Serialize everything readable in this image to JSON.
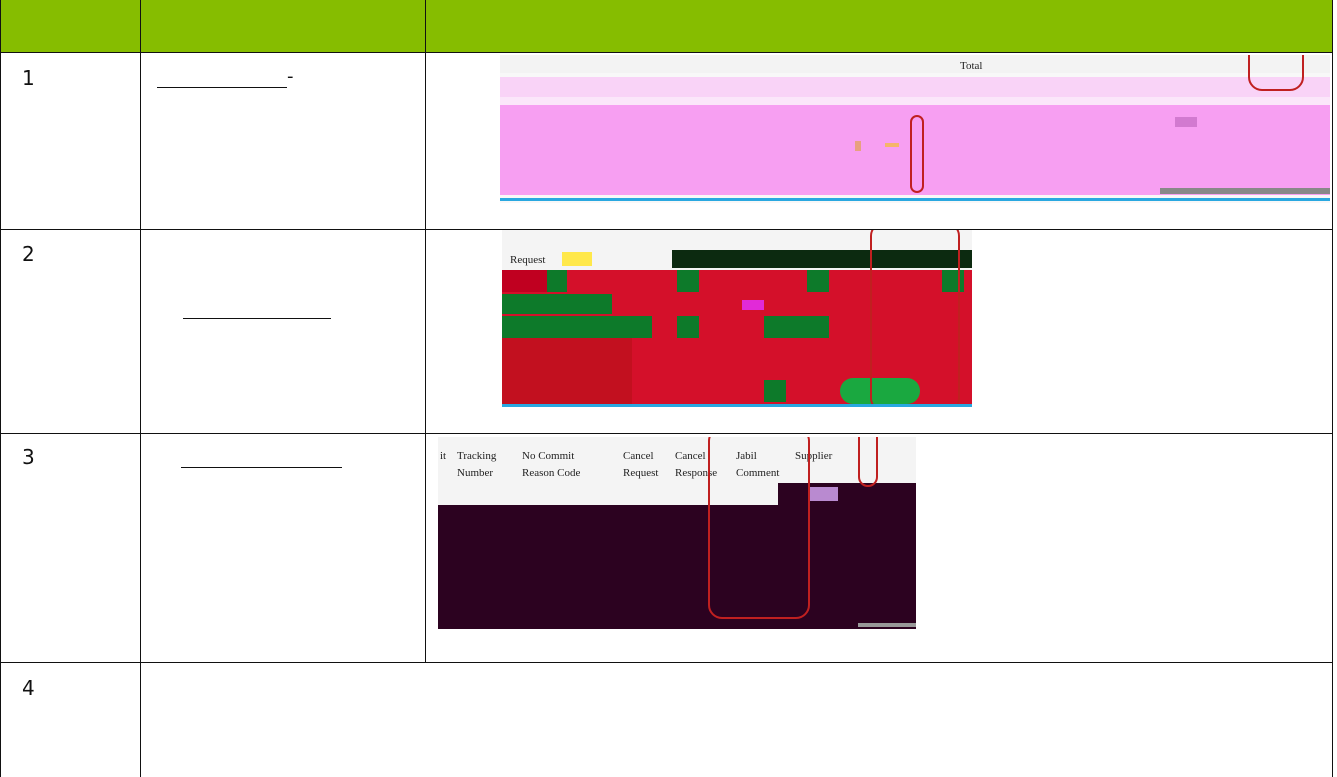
{
  "table": {
    "header_color": "#86bd00",
    "rows": [
      {
        "number": "1",
        "label_suffix": "-"
      },
      {
        "number": "2"
      },
      {
        "number": "3"
      },
      {
        "number": "4"
      }
    ]
  },
  "snippet1": {
    "total_label": "Total"
  },
  "snippet2": {
    "request_label": "Request"
  },
  "snippet3": {
    "columns": [
      {
        "line1": "it",
        "line2": ""
      },
      {
        "line1": "Tracking",
        "line2": "Number"
      },
      {
        "line1": "No Commit",
        "line2": "Reason Code"
      },
      {
        "line1": "Cancel",
        "line2": "Request"
      },
      {
        "line1": "Cancel",
        "line2": "Response"
      },
      {
        "line1": "Jabil",
        "line2": "Comment"
      },
      {
        "line1": "Supplier",
        "line2": ""
      }
    ]
  }
}
